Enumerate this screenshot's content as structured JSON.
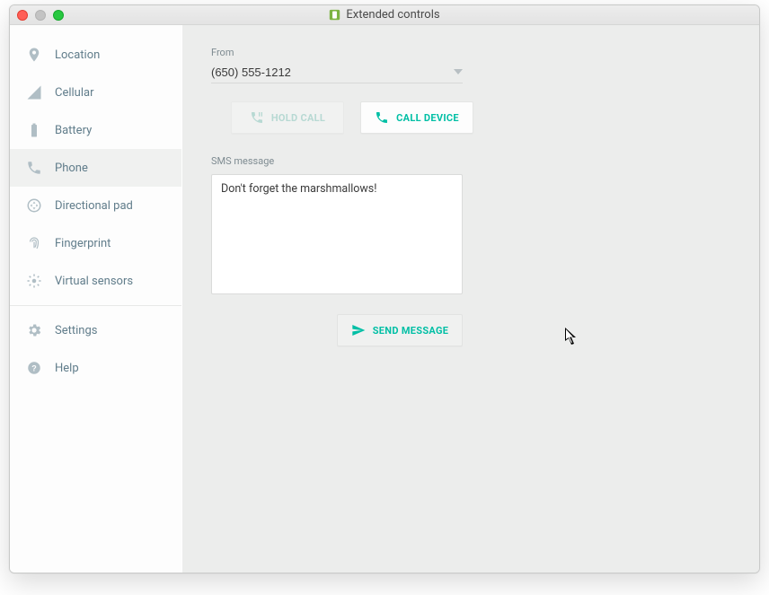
{
  "window": {
    "title": "Extended controls"
  },
  "sidebar": {
    "items": [
      {
        "id": "location",
        "label": "Location"
      },
      {
        "id": "cellular",
        "label": "Cellular"
      },
      {
        "id": "battery",
        "label": "Battery"
      },
      {
        "id": "phone",
        "label": "Phone"
      },
      {
        "id": "directional-pad",
        "label": "Directional pad"
      },
      {
        "id": "fingerprint",
        "label": "Fingerprint"
      },
      {
        "id": "virtual-sensors",
        "label": "Virtual sensors"
      },
      {
        "id": "settings",
        "label": "Settings"
      },
      {
        "id": "help",
        "label": "Help"
      }
    ],
    "selected": "phone"
  },
  "phone": {
    "from_label": "From",
    "from_value": "(650) 555-1212",
    "hold_call_label": "HOLD CALL",
    "call_device_label": "CALL DEVICE",
    "sms_label": "SMS message",
    "sms_value": "Don't forget the marshmallows!",
    "send_label": "SEND MESSAGE"
  }
}
